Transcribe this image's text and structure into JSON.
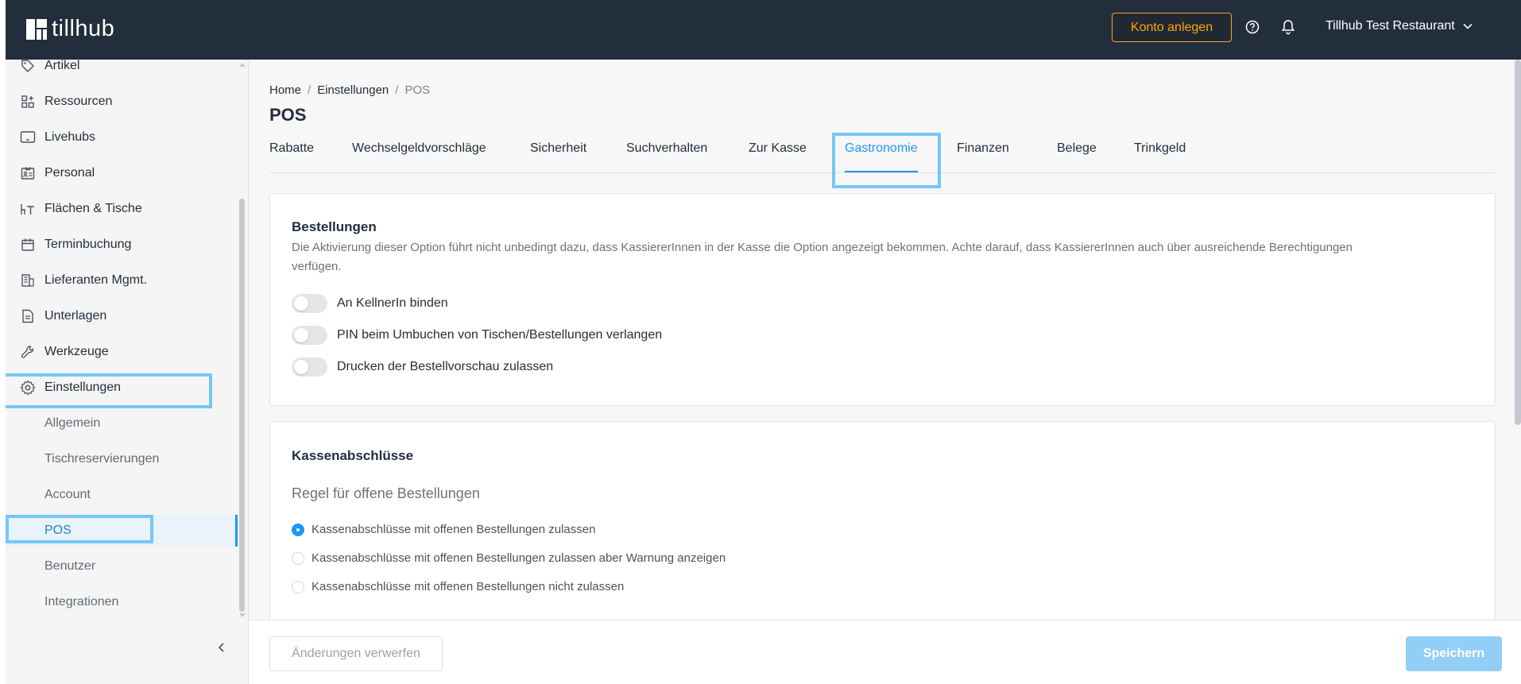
{
  "app": {
    "logo_text": "tillhub"
  },
  "header": {
    "konto_button": "Konto anlegen",
    "account_name": "Tillhub Test Restaurant"
  },
  "sidebar": {
    "items": [
      {
        "label": "Artikel",
        "icon": "tag-icon"
      },
      {
        "label": "Ressourcen",
        "icon": "resources-icon"
      },
      {
        "label": "Livehubs",
        "icon": "monitor-icon"
      },
      {
        "label": "Personal",
        "icon": "id-card-icon"
      },
      {
        "label": "Flächen & Tische",
        "icon": "table-icon"
      },
      {
        "label": "Terminbuchung",
        "icon": "calendar-icon"
      },
      {
        "label": "Lieferanten Mgmt.",
        "icon": "building-icon"
      },
      {
        "label": "Unterlagen",
        "icon": "document-icon"
      },
      {
        "label": "Werkzeuge",
        "icon": "wrench-icon"
      },
      {
        "label": "Einstellungen",
        "icon": "gear-icon"
      }
    ],
    "sub_items": [
      {
        "label": "Allgemein"
      },
      {
        "label": "Tischreservierungen"
      },
      {
        "label": "Account"
      },
      {
        "label": "POS",
        "active": true
      },
      {
        "label": "Benutzer"
      },
      {
        "label": "Integrationen"
      }
    ]
  },
  "breadcrumb": {
    "home": "Home",
    "settings": "Einstellungen",
    "current": "POS"
  },
  "page_title": "POS",
  "tabs": [
    {
      "label": "Rabatte"
    },
    {
      "label": "Wechselgeldvorschläge"
    },
    {
      "label": "Sicherheit"
    },
    {
      "label": "Suchverhalten"
    },
    {
      "label": "Zur Kasse"
    },
    {
      "label": "Gastronomie",
      "active": true
    },
    {
      "label": "Finanzen"
    },
    {
      "label": "Belege"
    },
    {
      "label": "Trinkgeld"
    }
  ],
  "orders_card": {
    "title": "Bestellungen",
    "description": "Die Aktivierung dieser Option führt nicht unbedingt dazu, dass KassiererInnen in der Kasse die Option angezeigt bekommen. Achte darauf, dass KassiererInnen auch über ausreichende Berechtigungen verfügen.",
    "toggles": [
      {
        "label": "An KellnerIn binden",
        "on": false
      },
      {
        "label": "PIN beim Umbuchen von Tischen/Bestellungen verlangen",
        "on": false
      },
      {
        "label": "Drucken der Bestellvorschau zulassen",
        "on": false
      }
    ]
  },
  "closing_card": {
    "title": "Kassenabschlüsse",
    "subheading": "Regel für offene Bestellungen",
    "options": [
      {
        "label": "Kassenabschlüsse mit offenen Bestellungen zulassen",
        "checked": true
      },
      {
        "label": "Kassenabschlüsse mit offenen Bestellungen zulassen aber Warnung anzeigen",
        "checked": false
      },
      {
        "label": "Kassenabschlüsse mit offenen Bestellungen nicht zulassen",
        "checked": false
      }
    ]
  },
  "footer": {
    "discard": "Änderungen verwerfen",
    "save": "Speichern"
  },
  "colors": {
    "topbar": "#232e3c",
    "accent": "#2196f3",
    "konto": "#ffa500",
    "highlight": "#75c8f5"
  }
}
